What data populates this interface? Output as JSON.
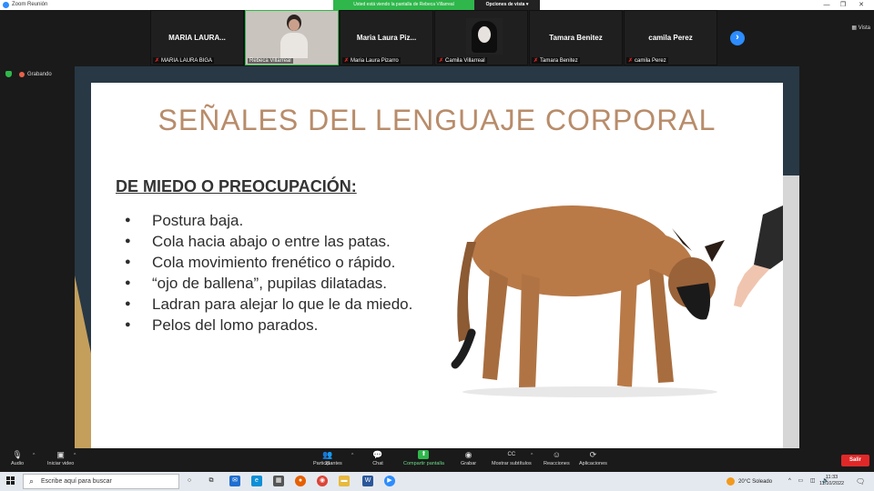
{
  "window": {
    "title": "Zoom Reunión",
    "minimize": "—",
    "restore": "❐",
    "close": "✕"
  },
  "share_banner": {
    "text": "Usted está viendo la pantalla de Rebeca Villarreal",
    "view_options": "Opciones de vista ▾"
  },
  "view_button": "Vista",
  "participants": [
    {
      "big_name": "MARIA LAURA...",
      "label": "MARIA LAURA BIGA",
      "muted": true,
      "video": false
    },
    {
      "big_name": "",
      "label": "Rebeca Villarreal",
      "muted": false,
      "video": true
    },
    {
      "big_name": "Maria Laura Piz...",
      "label": "Maria Laura Pizarro",
      "muted": true,
      "video": false
    },
    {
      "big_name": "",
      "label": "Camila Villarreal",
      "muted": true,
      "video": "photo"
    },
    {
      "big_name": "Tamara Benitez",
      "label": "Tamara Benitez",
      "muted": true,
      "video": false
    },
    {
      "big_name": "camila Perez",
      "label": "camila Perez",
      "muted": true,
      "video": false
    }
  ],
  "recording": {
    "label": "Grabando"
  },
  "slide": {
    "title": "SEÑALES DEL LENGUAJE CORPORAL",
    "subtitle": "DE MIEDO O PREOCUPACIÓN:",
    "bullets": [
      "Postura baja.",
      "Cola hacia abajo o entre las patas.",
      "Cola movimiento frenético o rápido.",
      "“ojo de ballena”, pupilas dilatadas.",
      "Ladran para alejar lo que le da miedo.",
      "Pelos del lomo parados."
    ]
  },
  "toolbar": {
    "audio": "Audio",
    "video": "Iniciar video",
    "participants": "Participantes",
    "participants_count": "21",
    "chat": "Chat",
    "share": "Compartir pantalla",
    "record": "Grabar",
    "captions": "Mostrar subtítulos",
    "reactions": "Reacciones",
    "apps": "Aplicaciones",
    "leave": "Salir"
  },
  "taskbar": {
    "search_placeholder": "Escribe aquí para buscar",
    "weather": "20°C  Soleado",
    "time": "11:33",
    "date": "11/10/2022"
  },
  "colors": {
    "share_green": "#2fb74b",
    "title_tan": "#b88c6a",
    "leave_red": "#e02828",
    "accent_blue": "#2d8cff"
  }
}
